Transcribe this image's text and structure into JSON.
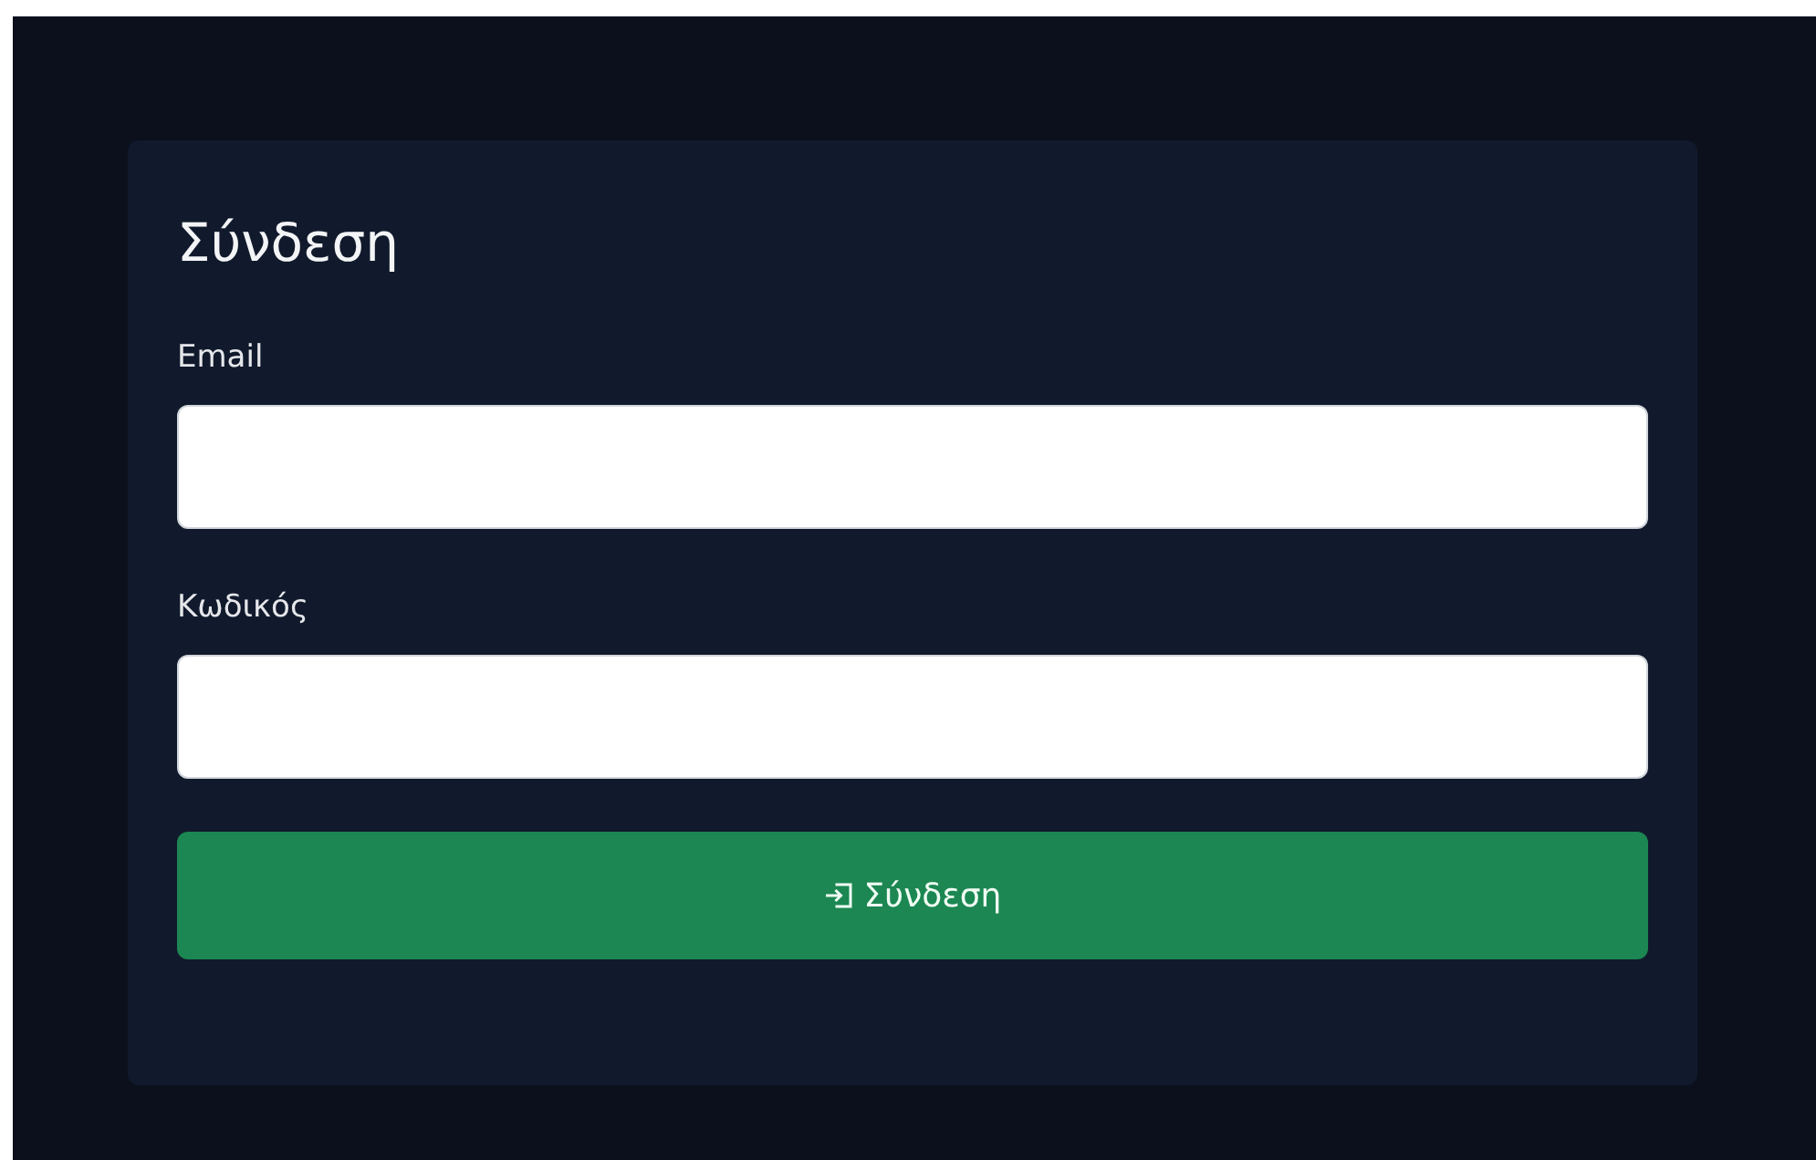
{
  "login": {
    "title": "Σύνδεση",
    "fields": [
      {
        "label": "Email"
      },
      {
        "label": "Κωδικός"
      }
    ],
    "submit": {
      "label": "Σύνδεση"
    }
  }
}
